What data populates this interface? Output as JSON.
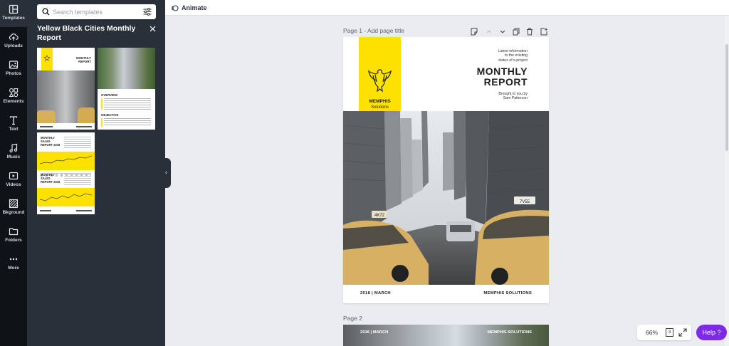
{
  "sidebar": {
    "items": [
      {
        "label": "Templates",
        "icon": "templates-icon"
      },
      {
        "label": "Uploads",
        "icon": "upload-cloud-icon"
      },
      {
        "label": "Photos",
        "icon": "photo-icon"
      },
      {
        "label": "Elements",
        "icon": "shapes-icon"
      },
      {
        "label": "Text",
        "icon": "text-icon"
      },
      {
        "label": "Music",
        "icon": "music-note-icon"
      },
      {
        "label": "Videos",
        "icon": "video-play-icon"
      },
      {
        "label": "Bkground",
        "icon": "background-pattern-icon"
      },
      {
        "label": "Folders",
        "icon": "folder-icon"
      },
      {
        "label": "More",
        "icon": "more-dots-icon"
      }
    ]
  },
  "panel": {
    "search_placeholder": "Search templates",
    "title": "Yellow Black Cities Monthly Report",
    "thumbs": {
      "cover_title": "MONTHLY REPORT",
      "overview": "OVERVIEW",
      "objective": "OBJECTIVE",
      "sales_2018": "MONTHLY SALES REPORT 2018",
      "sales_2019": "MONTHLY SALES REPORT 2019"
    }
  },
  "topbar": {
    "animate_label": "Animate"
  },
  "canvas": {
    "page1_label": "Page 1 - Add page title",
    "page2_label": "Page 2"
  },
  "document": {
    "brand_name": "MEMPHIS",
    "brand_sub": "Solutions",
    "info_lines": [
      "Latest information",
      "to the existing",
      "status of a project"
    ],
    "title_line1": "MONTHLY",
    "title_line2": "REPORT",
    "brought_lines": [
      "Brought to you by",
      "Sam Patterson"
    ],
    "footer_left": "2018 | MARCH",
    "footer_right": "MEMPHIS SOLUTIONS",
    "taxi_plate_1": "4K72",
    "taxi_plate_2": "7V55"
  },
  "page2_preview": {
    "left": "2018 | MARCH",
    "right": "MEMPHIS SOLUTIONS"
  },
  "status": {
    "zoom": "66%",
    "page_count": "3",
    "help_label": "Help ?"
  },
  "colors": {
    "accent_yellow": "#fde200",
    "help_purple": "#7d2ae8",
    "rail_bg": "#0e1318",
    "panel_bg": "#293039"
  }
}
